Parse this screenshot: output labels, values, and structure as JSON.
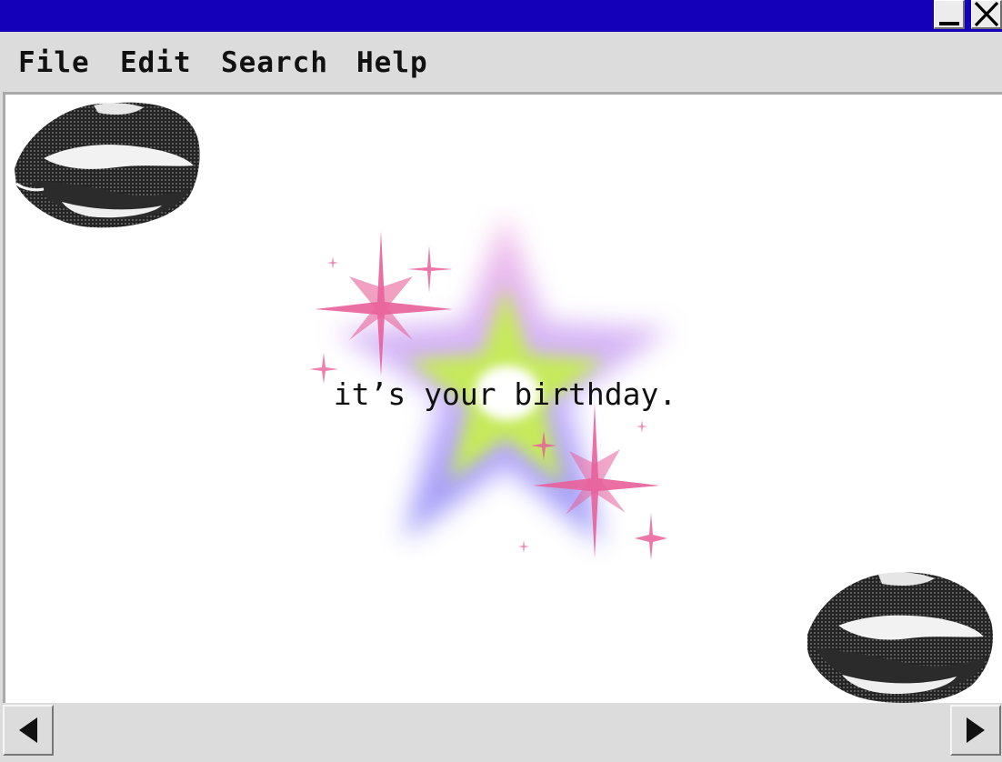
{
  "window": {
    "title_bar_color": "#1400b8",
    "minimize_icon": "minimize-icon",
    "close_icon": "close-icon"
  },
  "menu": {
    "file": "File",
    "edit": "Edit",
    "search": "Search",
    "help": "Help"
  },
  "content": {
    "message": "it’s your birthday.",
    "star_icon": "glowing-star-icon",
    "sparkle_icon": "sparkle-icon",
    "lips_icon": "lips-icon"
  },
  "scrollbar": {
    "left_icon": "arrow-left-icon",
    "right_icon": "arrow-right-icon"
  },
  "colors": {
    "accent_pink": "#e8609a",
    "star_green": "#c6ea5a",
    "star_lavender": "#b9a7ff",
    "star_pink": "#f4b6e4"
  }
}
